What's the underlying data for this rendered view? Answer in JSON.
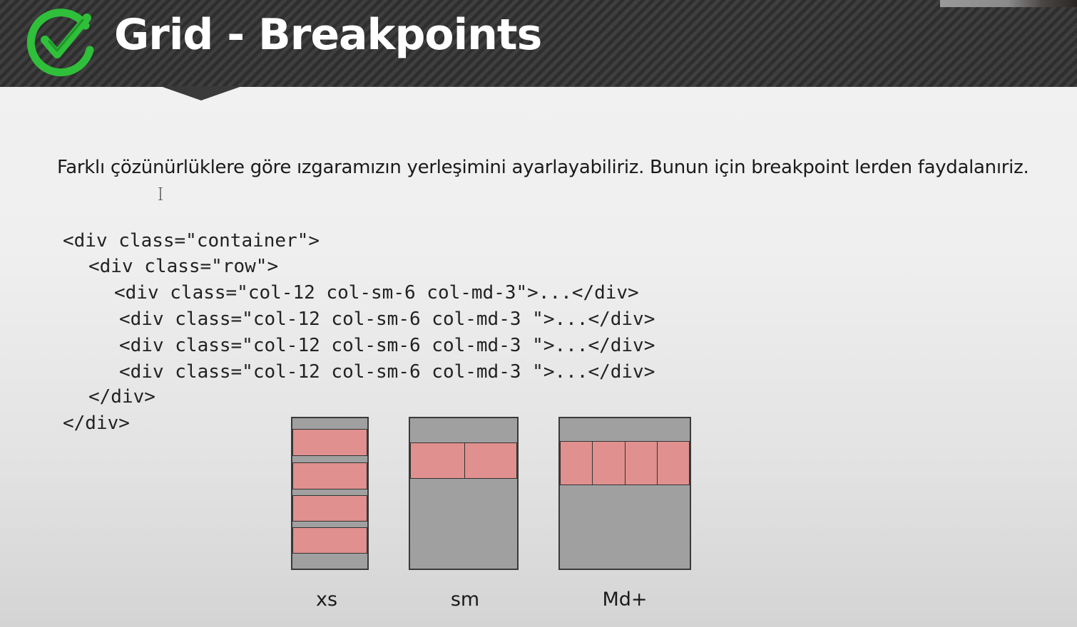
{
  "slide": {
    "title": "Grid - Breakpoints",
    "intro_text": "Farklı çözünürlüklere göre ızgaramızın yerleşimini ayarlayabiliriz. Bunun için breakpoint lerden faydalanıriz.",
    "logo_icon": "green-checkmark-icon",
    "accent_color": "#2fbf3a",
    "header_color": "#3a3a3a",
    "cell_color": "#e0908e",
    "box_color": "#a0a0a0"
  },
  "code": {
    "lines": [
      "<div class=\"container\">",
      "<div class=\"row\">",
      "<div class=\"col-12 col-sm-6 col-md-3\">...</div>",
      "<div class=\"col-12 col-sm-6 col-md-3 \">...</div>",
      "<div class=\"col-12 col-sm-6 col-md-3 \">...</div>",
      "<div class=\"col-12 col-sm-6 col-md-3 \">...</div>",
      "</div>",
      "</div>"
    ]
  },
  "diagrams": [
    {
      "label": "xs",
      "columns_per_row": 1,
      "rows": 4
    },
    {
      "label": "sm",
      "columns_per_row": 2,
      "rows": 1
    },
    {
      "label": "Md+",
      "columns_per_row": 4,
      "rows": 1
    }
  ]
}
